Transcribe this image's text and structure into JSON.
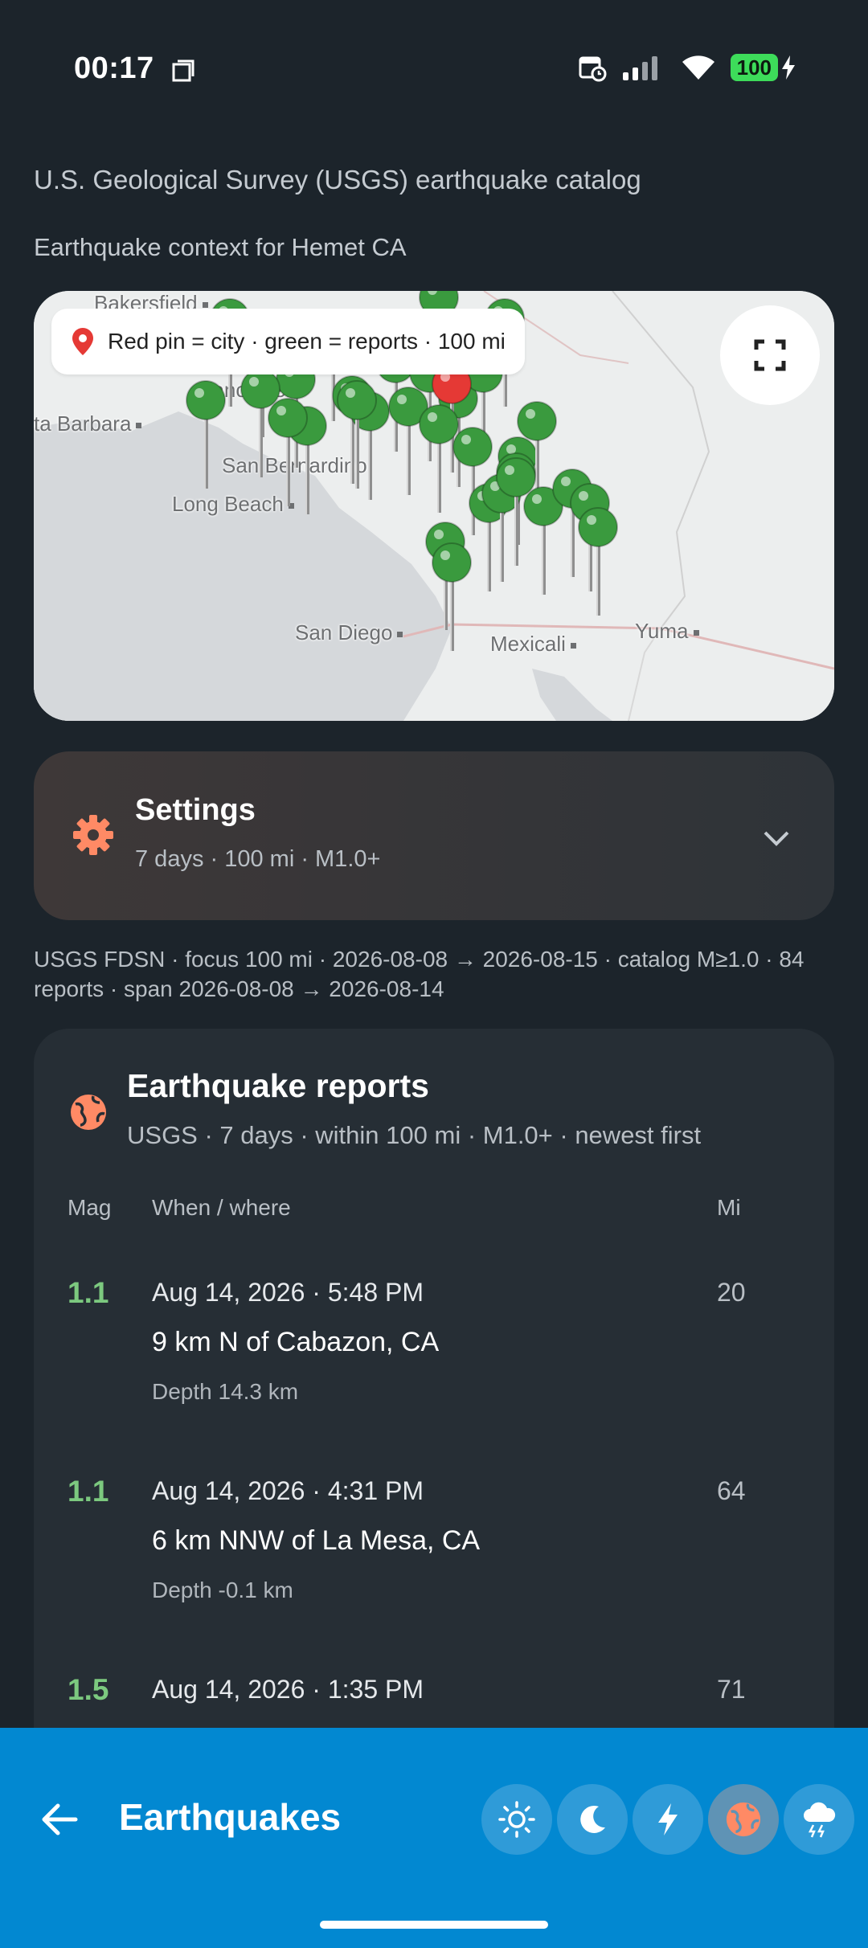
{
  "status_bar": {
    "time": "00:17",
    "battery": "100"
  },
  "header": {
    "source_caption": "U.S. Geological Survey (USGS) earthquake catalog",
    "context_caption": "Earthquake context for Hemet CA"
  },
  "map": {
    "legend": "Red pin = city · green = reports · 100 mi",
    "labels": {
      "bakersfield": "Bakersfield",
      "lancaster": "Lancaster",
      "santa_barbara": "ta Barbara",
      "san_bernardino": "San Bernardino",
      "long_beach": "Long Beach",
      "san_diego": "San Diego",
      "mexicali": "Mexicali",
      "yuma": "Yuma"
    }
  },
  "settings": {
    "title": "Settings",
    "summary": "7 days · 100 mi · M1.0+"
  },
  "query_meta": "USGS FDSN · focus 100 mi · 2026-08-08 → 2026-08-15 · catalog M≥1.0 · 84 reports · span 2026-08-08 → 2026-08-14",
  "reports": {
    "title": "Earthquake reports",
    "subtitle": "USGS · 7 days · within 100 mi · M1.0+ · newest first",
    "columns": {
      "mag": "Mag",
      "when_where": "When / where",
      "mi": "Mi"
    },
    "rows": [
      {
        "mag": "1.1",
        "when": "Aug 14, 2026 · 5:48 PM",
        "place": "9 km N of Cabazon, CA",
        "depth": "Depth 14.3 km",
        "mi": "20"
      },
      {
        "mag": "1.1",
        "when": "Aug 14, 2026 · 4:31 PM",
        "place": "6 km NNW of La Mesa, CA",
        "depth": "Depth -0.1 km",
        "mi": "64"
      },
      {
        "mag": "1.5",
        "when": "Aug 14, 2026 · 1:35 PM",
        "place": "",
        "depth": "",
        "mi": "71"
      }
    ]
  },
  "bottom_bar": {
    "title": "Earthquakes",
    "nav_icons": [
      "sun-icon",
      "moon-icon",
      "lightning-icon",
      "globe-icon",
      "storm-cloud-icon"
    ],
    "active": "globe-icon"
  },
  "colors": {
    "background": "#1c242b",
    "accent": "#0288d1",
    "magnitude": "#7cc97f",
    "icon_orange": "#ff8a65",
    "city_pin": "#e53935",
    "report_pin": "#3a9a3e"
  }
}
